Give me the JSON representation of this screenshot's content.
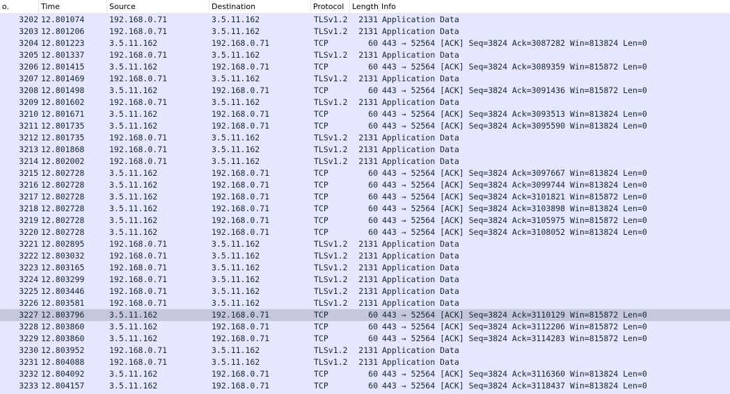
{
  "columns": {
    "no": "o.",
    "time": "Time",
    "source": "Source",
    "destination": "Destination",
    "protocol": "Protocol",
    "length": "Length",
    "info": "Info"
  },
  "selected_packet": "3227",
  "colors": {
    "row_background": "#e7e6ff",
    "selected_row_background": "#c7c7dc",
    "header_background": "#ffffff"
  },
  "packets": [
    {
      "no": "3202",
      "time": "12.801074",
      "source": "192.168.0.71",
      "destination": "3.5.11.162",
      "protocol": "TLSv1.2",
      "length": "2131",
      "info": "Application Data"
    },
    {
      "no": "3203",
      "time": "12.801206",
      "source": "192.168.0.71",
      "destination": "3.5.11.162",
      "protocol": "TLSv1.2",
      "length": "2131",
      "info": "Application Data"
    },
    {
      "no": "3204",
      "time": "12.801223",
      "source": "3.5.11.162",
      "destination": "192.168.0.71",
      "protocol": "TCP",
      "length": "60",
      "info": "443 → 52564 [ACK] Seq=3824 Ack=3087282 Win=813824 Len=0"
    },
    {
      "no": "3205",
      "time": "12.801337",
      "source": "192.168.0.71",
      "destination": "3.5.11.162",
      "protocol": "TLSv1.2",
      "length": "2131",
      "info": "Application Data"
    },
    {
      "no": "3206",
      "time": "12.801415",
      "source": "3.5.11.162",
      "destination": "192.168.0.71",
      "protocol": "TCP",
      "length": "60",
      "info": "443 → 52564 [ACK] Seq=3824 Ack=3089359 Win=815872 Len=0"
    },
    {
      "no": "3207",
      "time": "12.801469",
      "source": "192.168.0.71",
      "destination": "3.5.11.162",
      "protocol": "TLSv1.2",
      "length": "2131",
      "info": "Application Data"
    },
    {
      "no": "3208",
      "time": "12.801498",
      "source": "3.5.11.162",
      "destination": "192.168.0.71",
      "protocol": "TCP",
      "length": "60",
      "info": "443 → 52564 [ACK] Seq=3824 Ack=3091436 Win=815872 Len=0"
    },
    {
      "no": "3209",
      "time": "12.801602",
      "source": "192.168.0.71",
      "destination": "3.5.11.162",
      "protocol": "TLSv1.2",
      "length": "2131",
      "info": "Application Data"
    },
    {
      "no": "3210",
      "time": "12.801671",
      "source": "3.5.11.162",
      "destination": "192.168.0.71",
      "protocol": "TCP",
      "length": "60",
      "info": "443 → 52564 [ACK] Seq=3824 Ack=3093513 Win=813824 Len=0"
    },
    {
      "no": "3211",
      "time": "12.801735",
      "source": "3.5.11.162",
      "destination": "192.168.0.71",
      "protocol": "TCP",
      "length": "60",
      "info": "443 → 52564 [ACK] Seq=3824 Ack=3095590 Win=813824 Len=0"
    },
    {
      "no": "3212",
      "time": "12.801735",
      "source": "192.168.0.71",
      "destination": "3.5.11.162",
      "protocol": "TLSv1.2",
      "length": "2131",
      "info": "Application Data"
    },
    {
      "no": "3213",
      "time": "12.801868",
      "source": "192.168.0.71",
      "destination": "3.5.11.162",
      "protocol": "TLSv1.2",
      "length": "2131",
      "info": "Application Data"
    },
    {
      "no": "3214",
      "time": "12.802002",
      "source": "192.168.0.71",
      "destination": "3.5.11.162",
      "protocol": "TLSv1.2",
      "length": "2131",
      "info": "Application Data"
    },
    {
      "no": "3215",
      "time": "12.802728",
      "source": "3.5.11.162",
      "destination": "192.168.0.71",
      "protocol": "TCP",
      "length": "60",
      "info": "443 → 52564 [ACK] Seq=3824 Ack=3097667 Win=813824 Len=0"
    },
    {
      "no": "3216",
      "time": "12.802728",
      "source": "3.5.11.162",
      "destination": "192.168.0.71",
      "protocol": "TCP",
      "length": "60",
      "info": "443 → 52564 [ACK] Seq=3824 Ack=3099744 Win=813824 Len=0"
    },
    {
      "no": "3217",
      "time": "12.802728",
      "source": "3.5.11.162",
      "destination": "192.168.0.71",
      "protocol": "TCP",
      "length": "60",
      "info": "443 → 52564 [ACK] Seq=3824 Ack=3101821 Win=815872 Len=0"
    },
    {
      "no": "3218",
      "time": "12.802728",
      "source": "3.5.11.162",
      "destination": "192.168.0.71",
      "protocol": "TCP",
      "length": "60",
      "info": "443 → 52564 [ACK] Seq=3824 Ack=3103898 Win=813824 Len=0"
    },
    {
      "no": "3219",
      "time": "12.802728",
      "source": "3.5.11.162",
      "destination": "192.168.0.71",
      "protocol": "TCP",
      "length": "60",
      "info": "443 → 52564 [ACK] Seq=3824 Ack=3105975 Win=815872 Len=0"
    },
    {
      "no": "3220",
      "time": "12.802728",
      "source": "3.5.11.162",
      "destination": "192.168.0.71",
      "protocol": "TCP",
      "length": "60",
      "info": "443 → 52564 [ACK] Seq=3824 Ack=3108052 Win=813824 Len=0"
    },
    {
      "no": "3221",
      "time": "12.802895",
      "source": "192.168.0.71",
      "destination": "3.5.11.162",
      "protocol": "TLSv1.2",
      "length": "2131",
      "info": "Application Data"
    },
    {
      "no": "3222",
      "time": "12.803032",
      "source": "192.168.0.71",
      "destination": "3.5.11.162",
      "protocol": "TLSv1.2",
      "length": "2131",
      "info": "Application Data"
    },
    {
      "no": "3223",
      "time": "12.803165",
      "source": "192.168.0.71",
      "destination": "3.5.11.162",
      "protocol": "TLSv1.2",
      "length": "2131",
      "info": "Application Data"
    },
    {
      "no": "3224",
      "time": "12.803299",
      "source": "192.168.0.71",
      "destination": "3.5.11.162",
      "protocol": "TLSv1.2",
      "length": "2131",
      "info": "Application Data"
    },
    {
      "no": "3225",
      "time": "12.803446",
      "source": "192.168.0.71",
      "destination": "3.5.11.162",
      "protocol": "TLSv1.2",
      "length": "2131",
      "info": "Application Data"
    },
    {
      "no": "3226",
      "time": "12.803581",
      "source": "192.168.0.71",
      "destination": "3.5.11.162",
      "protocol": "TLSv1.2",
      "length": "2131",
      "info": "Application Data"
    },
    {
      "no": "3227",
      "time": "12.803796",
      "source": "3.5.11.162",
      "destination": "192.168.0.71",
      "protocol": "TCP",
      "length": "60",
      "info": "443 → 52564 [ACK] Seq=3824 Ack=3110129 Win=815872 Len=0"
    },
    {
      "no": "3228",
      "time": "12.803860",
      "source": "3.5.11.162",
      "destination": "192.168.0.71",
      "protocol": "TCP",
      "length": "60",
      "info": "443 → 52564 [ACK] Seq=3824 Ack=3112206 Win=815872 Len=0"
    },
    {
      "no": "3229",
      "time": "12.803860",
      "source": "3.5.11.162",
      "destination": "192.168.0.71",
      "protocol": "TCP",
      "length": "60",
      "info": "443 → 52564 [ACK] Seq=3824 Ack=3114283 Win=815872 Len=0"
    },
    {
      "no": "3230",
      "time": "12.803952",
      "source": "192.168.0.71",
      "destination": "3.5.11.162",
      "protocol": "TLSv1.2",
      "length": "2131",
      "info": "Application Data"
    },
    {
      "no": "3231",
      "time": "12.804088",
      "source": "192.168.0.71",
      "destination": "3.5.11.162",
      "protocol": "TLSv1.2",
      "length": "2131",
      "info": "Application Data"
    },
    {
      "no": "3232",
      "time": "12.804092",
      "source": "3.5.11.162",
      "destination": "192.168.0.71",
      "protocol": "TCP",
      "length": "60",
      "info": "443 → 52564 [ACK] Seq=3824 Ack=3116360 Win=813824 Len=0"
    },
    {
      "no": "3233",
      "time": "12.804157",
      "source": "3.5.11.162",
      "destination": "192.168.0.71",
      "protocol": "TCP",
      "length": "60",
      "info": "443 → 52564 [ACK] Seq=3824 Ack=3118437 Win=813824 Len=0"
    }
  ]
}
